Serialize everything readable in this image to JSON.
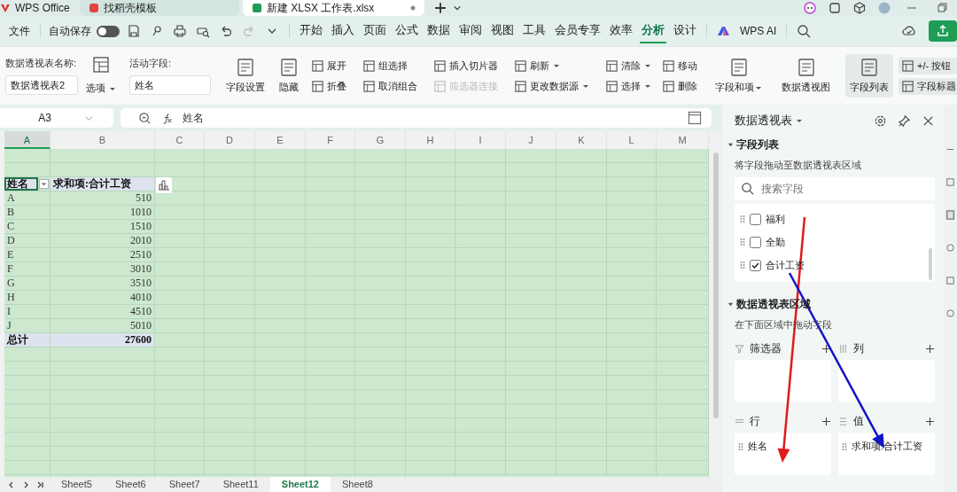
{
  "app_tabs": [
    {
      "label": "WPS Office",
      "selected": false
    },
    {
      "label": "找稻壳模板",
      "selected": false
    },
    {
      "label": "新建 XLSX 工作表.xlsx",
      "selected": true
    }
  ],
  "menu_bar": {
    "file": "文件",
    "autosave": {
      "label": "自动保存",
      "on": false
    },
    "tabs": [
      {
        "label": "开始",
        "selected": false
      },
      {
        "label": "插入",
        "selected": false
      },
      {
        "label": "页面",
        "selected": false
      },
      {
        "label": "公式",
        "selected": false
      },
      {
        "label": "数据",
        "selected": false
      },
      {
        "label": "审阅",
        "selected": false
      },
      {
        "label": "视图",
        "selected": false
      },
      {
        "label": "工具",
        "selected": false
      },
      {
        "label": "会员专享",
        "selected": false
      },
      {
        "label": "效率",
        "selected": false
      },
      {
        "label": "分析",
        "selected": true
      },
      {
        "label": "设计",
        "selected": false
      }
    ],
    "ai": "WPS AI"
  },
  "ribbon": {
    "pivot_name_label": "数据透视表名称:",
    "pivot_name": "数据透视表2",
    "options": "选项",
    "active_field_label": "活动字段:",
    "active_field": "姓名",
    "groups": [
      {
        "columns": [
          {
            "kind": "large",
            "label": "字段设置",
            "dropdown": false,
            "selected": false
          },
          {
            "kind": "large",
            "label": "隐藏",
            "dropdown": false,
            "selected": false
          },
          {
            "kind": "stack",
            "items": [
              {
                "label": "展开",
                "dropdown": false,
                "disabled": false,
                "selected": false
              },
              {
                "label": "折叠",
                "dropdown": false,
                "disabled": false,
                "selected": false
              }
            ]
          }
        ]
      },
      {
        "columns": [
          {
            "kind": "stack",
            "items": [
              {
                "label": "组选择",
                "dropdown": false,
                "disabled": false,
                "selected": false
              },
              {
                "label": "取消组合",
                "dropdown": false,
                "disabled": false,
                "selected": false
              }
            ]
          }
        ]
      },
      {
        "columns": [
          {
            "kind": "stack",
            "items": [
              {
                "label": "插入切片器",
                "dropdown": false,
                "disabled": false,
                "selected": false
              },
              {
                "label": "筛选器连接",
                "dropdown": false,
                "disabled": true,
                "selected": false
              }
            ]
          }
        ]
      },
      {
        "columns": [
          {
            "kind": "stack",
            "items": [
              {
                "label": "刷新",
                "dropdown": true,
                "disabled": false,
                "selected": false
              },
              {
                "label": "更改数据源",
                "dropdown": true,
                "disabled": false,
                "selected": false
              }
            ]
          }
        ]
      },
      {
        "columns": [
          {
            "kind": "stack",
            "items": [
              {
                "label": "清除",
                "dropdown": true,
                "disabled": false,
                "selected": false
              },
              {
                "label": "选择",
                "dropdown": true,
                "disabled": false,
                "selected": false
              }
            ]
          },
          {
            "kind": "stack",
            "items": [
              {
                "label": "移动",
                "dropdown": false,
                "disabled": false,
                "selected": false
              },
              {
                "label": "删除",
                "dropdown": false,
                "disabled": false,
                "selected": false
              }
            ]
          }
        ]
      },
      {
        "columns": [
          {
            "kind": "large",
            "label": "字段和项",
            "dropdown": true,
            "selected": false
          }
        ]
      },
      {
        "columns": [
          {
            "kind": "large",
            "label": "数据透视图",
            "dropdown": false,
            "selected": false
          }
        ]
      },
      {
        "columns": [
          {
            "kind": "large",
            "label": "字段列表",
            "dropdown": false,
            "selected": true
          },
          {
            "kind": "stack",
            "items": [
              {
                "label": "+/- 按钮",
                "dropdown": false,
                "disabled": false,
                "selected": true
              },
              {
                "label": "字段标题",
                "dropdown": false,
                "disabled": false,
                "selected": true
              }
            ]
          }
        ]
      }
    ]
  },
  "formula_bar": {
    "cell_ref": "A3",
    "formula": "姓名"
  },
  "sheet": {
    "columns": [
      {
        "label": "A",
        "selected": true
      },
      {
        "label": "B",
        "selected": false
      },
      {
        "label": "C",
        "selected": false
      },
      {
        "label": "D",
        "selected": false
      },
      {
        "label": "E",
        "selected": false
      },
      {
        "label": "F",
        "selected": false
      },
      {
        "label": "G",
        "selected": false
      },
      {
        "label": "H",
        "selected": false
      },
      {
        "label": "I",
        "selected": false
      },
      {
        "label": "J",
        "selected": false
      },
      {
        "label": "K",
        "selected": false
      },
      {
        "label": "L",
        "selected": false
      },
      {
        "label": "M",
        "selected": false
      }
    ],
    "pivot": {
      "header": [
        "姓名",
        "求和项:合计工资"
      ],
      "rows": [
        [
          "A",
          "510"
        ],
        [
          "B",
          "1010"
        ],
        [
          "C",
          "1510"
        ],
        [
          "D",
          "2010"
        ],
        [
          "E",
          "2510"
        ],
        [
          "F",
          "3010"
        ],
        [
          "G",
          "3510"
        ],
        [
          "H",
          "4010"
        ],
        [
          "I",
          "4510"
        ],
        [
          "J",
          "5010"
        ]
      ],
      "total": [
        "总计",
        "27600"
      ]
    }
  },
  "sheet_tabs": [
    {
      "label": "Sheet5",
      "selected": false
    },
    {
      "label": "Sheet6",
      "selected": false
    },
    {
      "label": "Sheet7",
      "selected": false
    },
    {
      "label": "Sheet11",
      "selected": false
    },
    {
      "label": "Sheet12",
      "selected": true
    },
    {
      "label": "Sheet8",
      "selected": false
    }
  ],
  "pivot_panel": {
    "title": "数据透视表",
    "field_list": {
      "heading": "字段列表",
      "hint": "将字段拖动至数据透视表区域",
      "search_placeholder": "搜索字段",
      "fields": [
        {
          "label": "福利",
          "checked": false
        },
        {
          "label": "全勤",
          "checked": false
        },
        {
          "label": "合计工资",
          "checked": true
        }
      ]
    },
    "areas": {
      "heading": "数据透视表区域",
      "hint": "在下面区域中拖动字段",
      "zones": [
        {
          "kind": "filter",
          "label": "筛选器"
        },
        {
          "kind": "column",
          "label": "列"
        },
        {
          "kind": "row",
          "label": "行",
          "items": [
            "姓名"
          ]
        },
        {
          "kind": "value",
          "label": "值",
          "items": [
            "求和项:合计工资"
          ]
        }
      ]
    }
  },
  "annotations": [
    {
      "kind": "arrow",
      "color": "#e01b1b"
    },
    {
      "kind": "arrow",
      "color": "#1414c8"
    }
  ]
}
